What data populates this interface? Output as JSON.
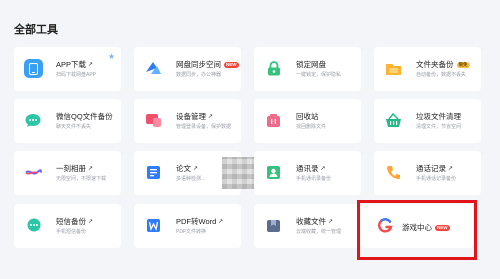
{
  "page": {
    "title": "全部工具"
  },
  "tools": [
    {
      "key": "app",
      "name": "APP下载",
      "desc": "扫码下载网盘APP",
      "icon": "phone-icon",
      "color": "#3aa0f2",
      "arrow": true
    },
    {
      "key": "sync",
      "name": "网盘同步空间",
      "desc": "数据同步，办公神器",
      "icon": "sync-icon",
      "color": "#2f7cf6",
      "badge": "NEW",
      "badge_type": "new"
    },
    {
      "key": "safe",
      "name": "锁定网盘",
      "desc": "一键锁定，保护隐私",
      "icon": "lock-icon",
      "color": "#35c27d"
    },
    {
      "key": "folder",
      "name": "文件夹备份",
      "desc": "自动备份，数据不丢失",
      "icon": "folder-icon",
      "color": "#ffb42f",
      "badge": "限免",
      "badge_type": "gold"
    },
    {
      "key": "wechat",
      "name": "微信QQ文件备份",
      "desc": "聊天文件不丢失",
      "icon": "chat-icon",
      "color": "#2cc5a6"
    },
    {
      "key": "device",
      "name": "设备管理",
      "desc": "管理登录设备，保护数据",
      "icon": "device-icon",
      "color": "#f0506e",
      "arrow": true
    },
    {
      "key": "recycle",
      "name": "回收站",
      "desc": "找回删除文件",
      "icon": "trash-icon",
      "color": "#f06a8a"
    },
    {
      "key": "clean",
      "name": "垃圾文件清理",
      "desc": "清理文件，节省空间",
      "icon": "basket-icon",
      "color": "#25b98a"
    },
    {
      "key": "ikeqie",
      "name": "一刻相册",
      "desc": "无限空间，不限速下载",
      "icon": "album-icon",
      "color": "#6f5ef6",
      "arrow": true
    },
    {
      "key": "paper",
      "name": "论文",
      "desc": "多语种检测...",
      "icon": "paper-icon",
      "color": "#2f7cf6",
      "arrow": true
    },
    {
      "key": "contacts",
      "name": "通讯录",
      "desc": "手机通讯录备份",
      "icon": "contacts-icon",
      "color": "#35c27d",
      "arrow": true
    },
    {
      "key": "calls",
      "name": "通话记录",
      "desc": "手机通话记录备份",
      "icon": "phone-call-icon",
      "color": "#ffa52f",
      "arrow": true
    },
    {
      "key": "sms",
      "name": "短信备份",
      "desc": "手机短信备份",
      "icon": "sms-icon",
      "color": "#2cc5a6",
      "arrow": true
    },
    {
      "key": "pdf",
      "name": "PDF转Word",
      "desc": "PDF文件转换",
      "icon": "pdf-icon",
      "color": "#2f7cf6",
      "arrow": true
    },
    {
      "key": "collect",
      "name": "收藏文件",
      "desc": "云端收藏，统一管理",
      "icon": "bookmark-icon",
      "color": "#5b6c8c",
      "arrow": true
    },
    {
      "key": "game",
      "name": "游戏中心",
      "desc": "",
      "icon": "game-icon",
      "color": "#f14c4c",
      "badge": "NEW",
      "badge_type": "new"
    }
  ]
}
